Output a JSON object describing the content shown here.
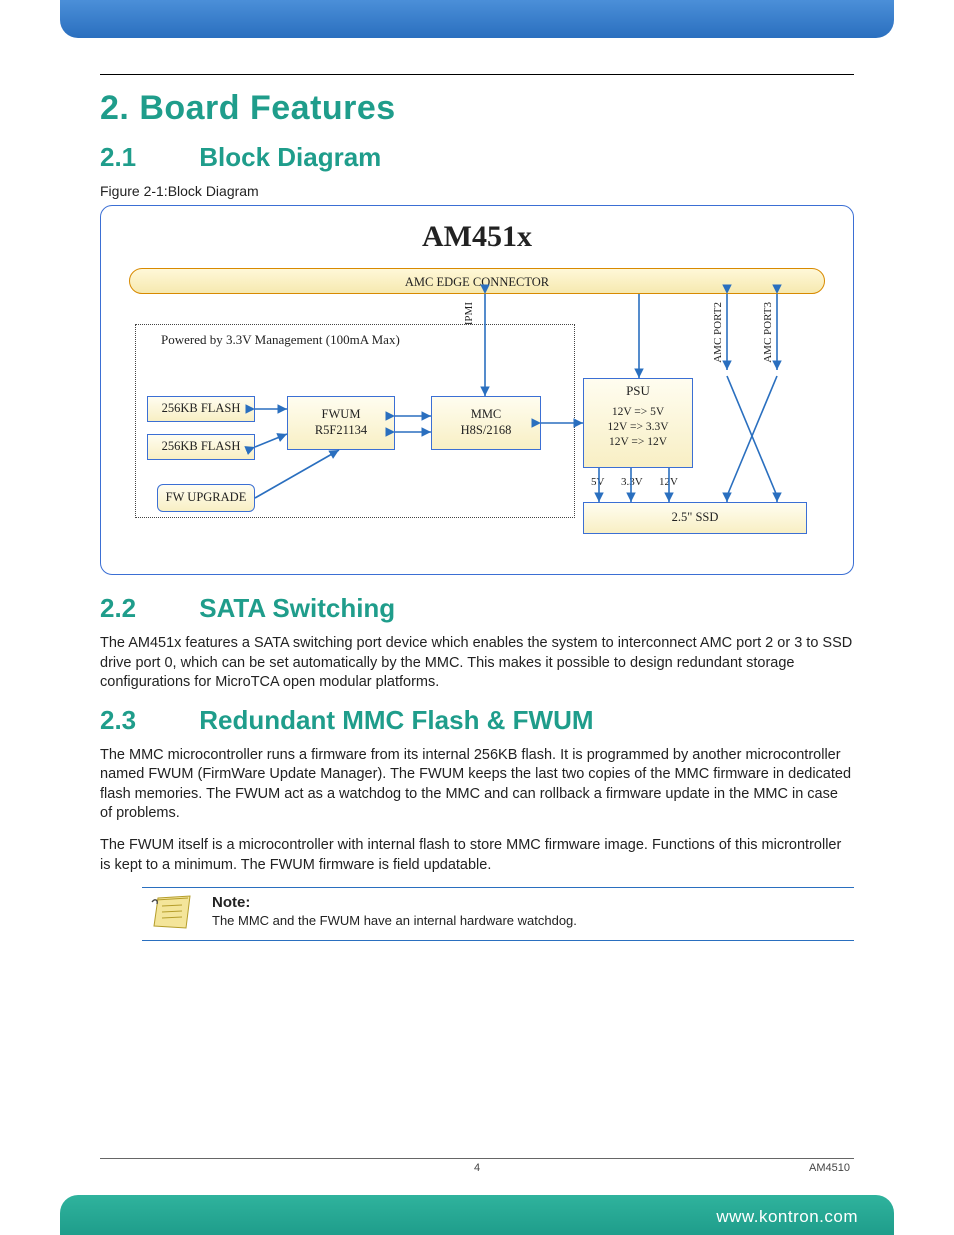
{
  "chapter": {
    "number": "2.",
    "title": "Board Features"
  },
  "sections": {
    "s1": {
      "num": "2.1",
      "title": "Block Diagram"
    },
    "s2": {
      "num": "2.2",
      "title": "SATA Switching"
    },
    "s3": {
      "num": "2.3",
      "title": "Redundant MMC Flash & FWUM"
    }
  },
  "figure": {
    "label": "Figure 2-1:Block Diagram"
  },
  "diagram": {
    "title": "AM451x",
    "amc_edge": "AMC EDGE CONNECTOR",
    "mgmt_label": "Powered by 3.3V Management (100mA Max)",
    "flash1": "256KB FLASH",
    "flash2": "256KB FLASH",
    "fwum_l1": "FWUM",
    "fwum_l2": "R5F21134",
    "fw_upgrade": "FW UPGRADE",
    "mmc_l1": "MMC",
    "mmc_l2": "H8S/2168",
    "psu_title": "PSU",
    "psu_l1": "12V => 5V",
    "psu_l2": "12V => 3.3V",
    "psu_l3": "12V => 12V",
    "psu_out_5v": "5V",
    "psu_out_33v": "3.3V",
    "psu_out_12v": "12V",
    "ssd": "2.5\" SSD",
    "ipmi": "IPMI",
    "port2": "AMC PORT2",
    "port3": "AMC PORT3"
  },
  "para_sata": "The AM451x features a SATA switching port device which enables the system to interconnect AMC port 2 or 3 to SSD drive port 0, which can be set automatically by the MMC. This makes it possible to design redundant storage configurations for MicroTCA open modular platforms.",
  "para_mmc1": "The MMC microcontroller runs a firmware from its internal 256KB flash. It is programmed by another microcontroller named FWUM (FirmWare Update Manager). The FWUM keeps the last two copies of the MMC firmware in dedicated flash memories. The FWUM act as a watchdog to the MMC and can rollback a firmware update in the MMC in case of problems.",
  "para_mmc2": "The FWUM itself is a microcontroller with internal flash to store MMC firmware image. Functions of this microntroller is kept to a minimum. The FWUM firmware is field updatable.",
  "note": {
    "title": "Note:",
    "text": "The MMC and the FWUM have an internal hardware watchdog."
  },
  "footer": {
    "page": "4",
    "model": "AM4510",
    "url": "www.kontron.com"
  }
}
